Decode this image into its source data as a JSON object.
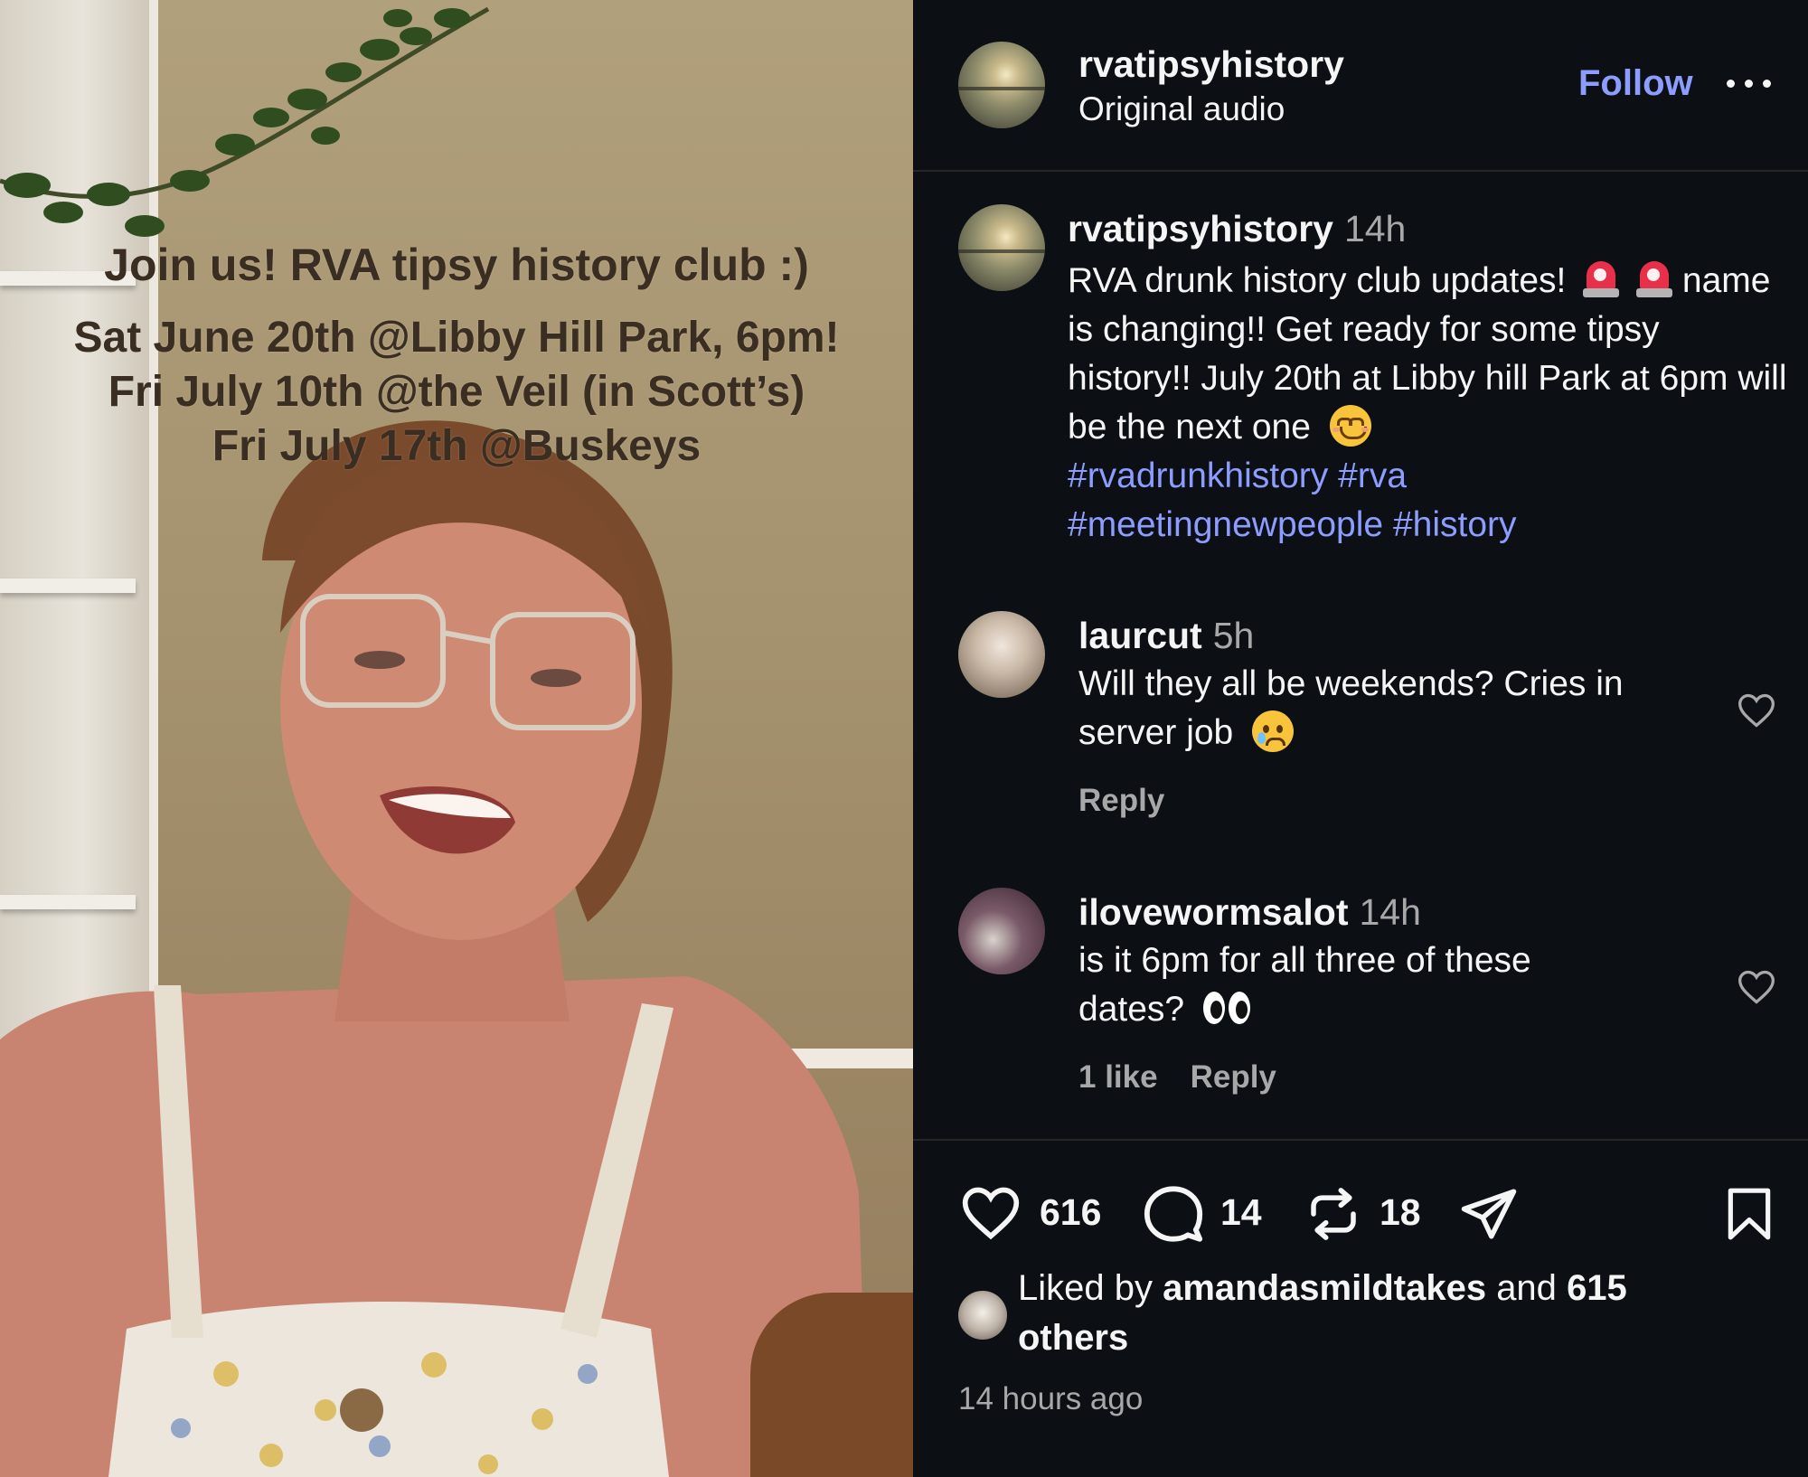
{
  "video": {
    "overlay_title": "Join us! RVA tipsy history club :)",
    "overlay_lines": [
      "Sat June 20th @Libby Hill Park, 6pm!",
      "Fri July 10th @the Veil (in Scott’s)",
      "Fri July 17th @Buskeys"
    ]
  },
  "header": {
    "username": "rvatipsyhistory",
    "audio": "Original audio",
    "follow_label": "Follow",
    "avatar_icon": "sunset-avatar"
  },
  "caption": {
    "username": "rvatipsyhistory",
    "time": "14h",
    "text_part1": "RVA drunk history club updates!",
    "emoji_1": "siren-icon",
    "emoji_2": "siren-icon",
    "text_part2": " name is changing!! Get ready for some tipsy history!! July 20th at Libby hill Park at 6pm will be the next one",
    "emoji_3": "smiling-face-icon",
    "hashtags": [
      "#rvadrunkhistory",
      "#rva",
      "#meetingnewpeople",
      "#history"
    ]
  },
  "comments": [
    {
      "username": "laurcut",
      "time": "5h",
      "text": "Will they all be weekends? Cries in server job",
      "emoji": "crying-face-icon",
      "likes_label": "",
      "reply_label": "Reply"
    },
    {
      "username": "ilovewormsalot",
      "time": "14h",
      "text": "is it 6pm for all three of these dates?",
      "emoji": "eyes-icon",
      "likes_label": "1 like",
      "reply_label": "Reply"
    }
  ],
  "actions": {
    "likes": "616",
    "comments": "14",
    "reposts": "18"
  },
  "liked_by": {
    "prefix": "Liked by",
    "user": "amandasmildtakes",
    "middle": "and",
    "count": "615",
    "suffix": "others"
  },
  "posted_ago": "14 hours ago",
  "colors": {
    "background": "#0c1014",
    "accent": "#8c9dff",
    "secondary_text": "#a8a8a8"
  }
}
